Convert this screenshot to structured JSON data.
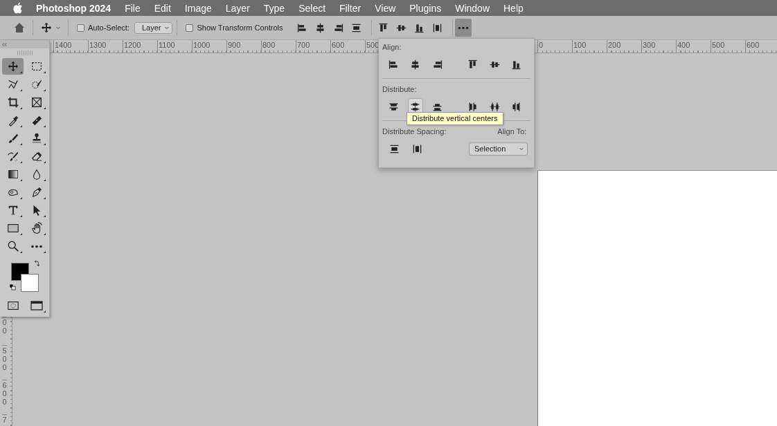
{
  "menu_bar": {
    "app_name": "Photoshop 2024",
    "items": [
      "File",
      "Edit",
      "Image",
      "Layer",
      "Type",
      "Select",
      "Filter",
      "View",
      "Plugins",
      "Window",
      "Help"
    ]
  },
  "options_bar": {
    "auto_select": {
      "label": "Auto-Select:",
      "checked": false
    },
    "target": {
      "value": "Layer"
    },
    "transform_controls": {
      "label": "Show Transform Controls",
      "checked": false
    },
    "more_button": {
      "selected": true
    }
  },
  "top_ruler": {
    "left_labels": [
      "1400",
      "1300",
      "1200",
      "1100",
      "1000",
      "900",
      "800",
      "700",
      "600",
      "500"
    ],
    "right_labels": [
      "0",
      "100",
      "200",
      "300",
      "400",
      "500",
      "600"
    ]
  },
  "left_ruler": {
    "labels": [
      "00",
      "500",
      "600",
      "7"
    ]
  },
  "tools": [
    {
      "selected": true
    },
    {
      "selected": false
    },
    {
      "selected": false
    },
    {
      "selected": false
    },
    {
      "selected": false
    },
    {
      "selected": false
    },
    {
      "selected": false
    },
    {
      "selected": false
    },
    {
      "selected": false
    },
    {
      "selected": false
    },
    {
      "selected": false
    },
    {
      "selected": false
    },
    {
      "selected": false
    },
    {
      "selected": false
    },
    {
      "selected": false
    },
    {
      "selected": false
    },
    {
      "selected": false
    },
    {
      "selected": false
    },
    {
      "selected": false
    },
    {
      "selected": false
    },
    {
      "selected": false
    },
    {
      "selected": false
    }
  ],
  "align_popup": {
    "align_label": "Align:",
    "align_buttons": [
      {
        "selected": false
      },
      {
        "selected": false
      },
      {
        "selected": false
      },
      {
        "selected": false
      },
      {
        "selected": false
      },
      {
        "selected": false
      }
    ],
    "distribute_label": "Distribute:",
    "distribute_buttons": [
      {
        "selected": false
      },
      {
        "selected": true
      },
      {
        "selected": false
      },
      {
        "selected": false
      },
      {
        "selected": false
      },
      {
        "selected": false
      }
    ],
    "spacing_label": "Distribute Spacing:",
    "align_to_label": "Align To:",
    "spacing_buttons": [
      {
        "selected": false
      },
      {
        "selected": false
      }
    ],
    "align_to": {
      "value": "Selection"
    },
    "tooltip": "Distribute vertical centers"
  }
}
